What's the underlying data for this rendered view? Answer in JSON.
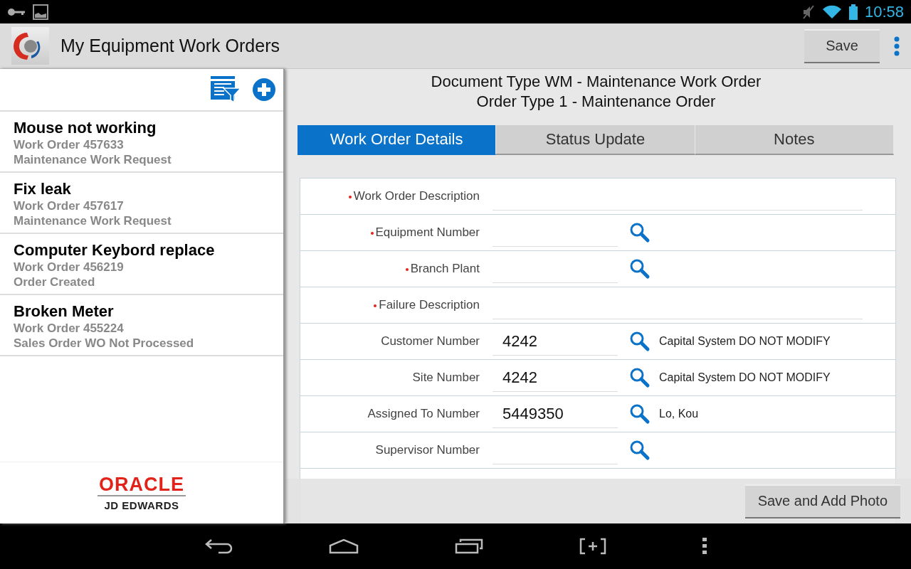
{
  "status_bar": {
    "time": "10:58"
  },
  "app_bar": {
    "title": "My Equipment Work Orders",
    "save_button": "Save"
  },
  "orders": [
    {
      "title": "Mouse not working",
      "number": "Work Order 457633",
      "status": "Maintenance Work Request"
    },
    {
      "title": "Fix leak",
      "number": "Work Order 457617",
      "status": "Maintenance Work Request"
    },
    {
      "title": "Computer Keybord replace",
      "number": "Work Order 456219",
      "status": "Order Created"
    },
    {
      "title": "Broken Meter",
      "number": "Work Order 455224",
      "status": "Sales Order WO Not Processed"
    }
  ],
  "logo": {
    "brand": "ORACLE",
    "product": "JD EDWARDS"
  },
  "header": {
    "document_type": "Document Type WM - Maintenance Work Order",
    "order_type": "Order Type 1 - Maintenance Order"
  },
  "tabs": [
    {
      "label": "Work Order Details",
      "selected": true
    },
    {
      "label": "Status Update",
      "selected": false
    },
    {
      "label": "Notes",
      "selected": false
    }
  ],
  "fields": [
    {
      "kind": "wide",
      "label": "Work Order Description",
      "required": true
    },
    {
      "kind": "lookup",
      "label": "Equipment Number",
      "required": true
    },
    {
      "kind": "lookup",
      "label": "Branch Plant",
      "required": true
    },
    {
      "kind": "wide",
      "label": "Failure Description",
      "required": true
    },
    {
      "kind": "lookup",
      "label": "Customer Number",
      "required": false,
      "value": "4242",
      "description": "Capital System DO NOT MODIFY"
    },
    {
      "kind": "lookup",
      "label": "Site Number",
      "required": false,
      "value": "4242",
      "description": "Capital System DO NOT MODIFY"
    },
    {
      "kind": "lookup",
      "label": "Assigned To Number",
      "required": false,
      "value": "5449350",
      "description": "Lo, Kou"
    },
    {
      "kind": "lookup",
      "label": "Supervisor Number",
      "required": false
    }
  ],
  "photo_button": "Save and Add Photo"
}
